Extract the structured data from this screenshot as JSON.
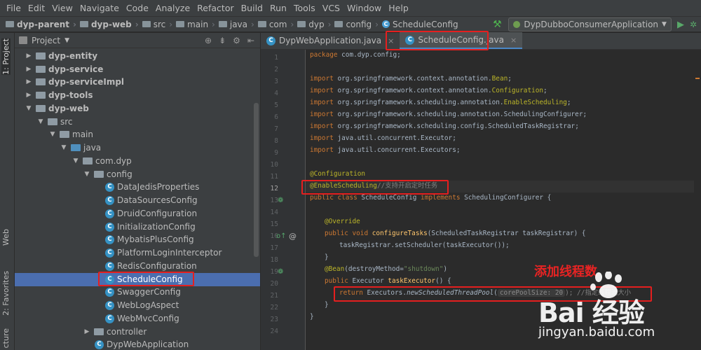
{
  "menu": [
    "File",
    "Edit",
    "View",
    "Navigate",
    "Code",
    "Analyze",
    "Refactor",
    "Build",
    "Run",
    "Tools",
    "VCS",
    "Window",
    "Help"
  ],
  "breadcrumbs": [
    "dyp-parent",
    "dyp-web",
    "src",
    "main",
    "java",
    "com",
    "dyp",
    "config",
    "ScheduleConfig"
  ],
  "run_config": "DypDubboConsumerApplication",
  "left_strip": {
    "project": "1: Project",
    "web": "Web",
    "favorites": "2: Favorites",
    "structure": "cture"
  },
  "project": {
    "title": "Project",
    "tree": [
      {
        "label": "dyp-entity"
      },
      {
        "label": "dyp-service"
      },
      {
        "label": "dyp-serviceImpl"
      },
      {
        "label": "dyp-tools"
      },
      {
        "label": "dyp-web"
      },
      {
        "label": "src"
      },
      {
        "label": "main"
      },
      {
        "label": "java"
      },
      {
        "label": "com.dyp"
      },
      {
        "label": "config"
      },
      {
        "label": "DataJedisProperties"
      },
      {
        "label": "DataSourcesConfig"
      },
      {
        "label": "DruidConfiguration"
      },
      {
        "label": "InitializationConfig"
      },
      {
        "label": "MybatisPlusConfig"
      },
      {
        "label": "PlatformLoginInterceptor"
      },
      {
        "label": "RedisConfiguration"
      },
      {
        "label": "ScheduleConfig"
      },
      {
        "label": "SwaggerConfig"
      },
      {
        "label": "WebLogAspect"
      },
      {
        "label": "WebMvcConfig"
      },
      {
        "label": "controller"
      },
      {
        "label": "DypWebApplication"
      }
    ]
  },
  "tabs": [
    {
      "label": "DypWebApplication.java"
    },
    {
      "label": "ScheduleConfig.java"
    }
  ],
  "line_numbers": [
    "1",
    "2",
    "3",
    "4",
    "5",
    "6",
    "7",
    "8",
    "9",
    "10",
    "11",
    "12",
    "13",
    "14",
    "15",
    "16",
    "17",
    "18",
    "19",
    "20",
    "21",
    "22",
    "23",
    "24"
  ],
  "code": {
    "l1_kw": "package",
    "l1_rest": " com.dyp.config;",
    "l3_kw": "import",
    "l3_a": " org.springframework.context.annotation.",
    "l3_b": "Bean",
    "l4_kw": "import",
    "l4_a": " org.springframework.context.annotation.",
    "l4_b": "Configuration",
    "l5_kw": "import",
    "l5_a": " org.springframework.scheduling.annotation.",
    "l5_b": "EnableScheduling",
    "l6_kw": "import",
    "l6_a": " org.springframework.scheduling.annotation.SchedulingConfigurer",
    "l7_kw": "import",
    "l7_a": " org.springframework.scheduling.config.ScheduledTaskRegistrar",
    "l8_kw": "import",
    "l8_a": " java.util.concurrent.Executor",
    "l9_kw": "import",
    "l9_a": " java.util.concurrent.Executors",
    "semi": ";",
    "l11": "@Configuration",
    "l12_ann": "@EnableScheduling",
    "l12_cmt": "//支持开启定时任务",
    "l13_kw": "public class",
    "l13_a": " ScheduleConfig ",
    "l13_kw2": "implements",
    "l13_b": " SchedulingConfigurer {",
    "l15": "@Override",
    "l16_kw": "public void",
    "l16_fn": " configureTasks",
    "l16_b": "(ScheduledTaskRegistrar taskRegistrar) {",
    "l17": "taskRegistrar.setScheduler(taskExecutor());",
    "l18": "}",
    "l19_ann": "@Bean",
    "l19_a": "(destroyMethod=",
    "l19_str": "\"shutdown\"",
    "l19_b": ")",
    "l20_kw": "public",
    "l20_a": " Executor ",
    "l20_fn": "taskExecutor",
    "l20_b": "() {",
    "l21_kw": "return",
    "l21_a": " Executors.",
    "l21_it": "newScheduledThreadPool",
    "l21_b": "(",
    "l21_hint": "corePoolSize: 20",
    "l21_c": "); //指定线程池大小",
    "l22": "}",
    "l23": "}"
  },
  "annotation_text": "添加线程数",
  "watermark": {
    "logo": "Bai 经验",
    "url": "jingyan.baidu.com"
  }
}
